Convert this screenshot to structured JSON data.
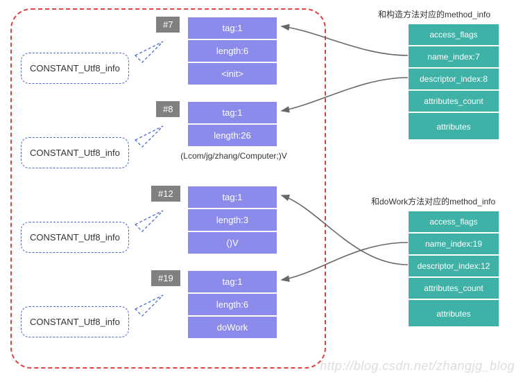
{
  "constants": {
    "c7": {
      "index": "#7",
      "tag": "tag:1",
      "length": "length:6",
      "value": "<init>"
    },
    "c8": {
      "index": "#8",
      "tag": "tag:1",
      "length": "length:26",
      "value": "(Lcom/jg/zhang/Computer;)V"
    },
    "c12": {
      "index": "#12",
      "tag": "tag:1",
      "length": "length:3",
      "value": "()V"
    },
    "c19": {
      "index": "#19",
      "tag": "tag:1",
      "length": "length:6",
      "value": "doWork"
    }
  },
  "callout_label": "CONSTANT_Utf8_info",
  "method_info_1": {
    "title": "和构造方法对应的method_info",
    "rows": [
      "access_flags",
      "name_index:7",
      "descriptor_index:8",
      "attributes_count",
      "attributes"
    ]
  },
  "method_info_2": {
    "title": "和doWork方法对应的method_info",
    "rows": [
      "access_flags",
      "name_index:19",
      "descriptor_index:12",
      "attributes_count",
      "attributes"
    ]
  },
  "watermark": "http://blog.csdn.net/zhangjg_blog"
}
